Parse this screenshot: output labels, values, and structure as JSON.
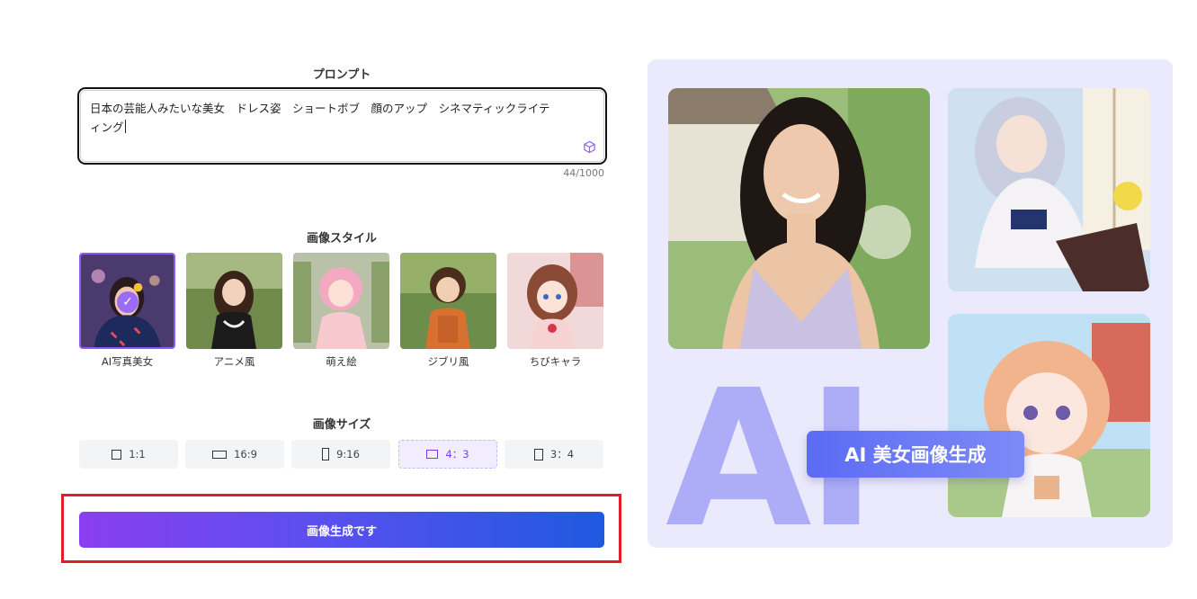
{
  "prompt_section": {
    "title": "プロンプト",
    "text": "日本の芸能人みたいな美女　ドレス姿　ショートボブ　顔のアップ　シネマティックライティング",
    "counter": "44/1000"
  },
  "style_section": {
    "title": "画像スタイル",
    "styles": [
      {
        "label": "AI写真美女",
        "selected": true
      },
      {
        "label": "アニメ風",
        "selected": false
      },
      {
        "label": "萌え絵",
        "selected": false
      },
      {
        "label": "ジブリ風",
        "selected": false
      },
      {
        "label": "ちびキャラ",
        "selected": false
      }
    ]
  },
  "size_section": {
    "title": "画像サイズ",
    "sizes": [
      {
        "label": "1:1",
        "selected": false
      },
      {
        "label": "16:9",
        "selected": false
      },
      {
        "label": "9:16",
        "selected": false
      },
      {
        "label": "4：3",
        "selected": true
      },
      {
        "label": "3：4",
        "selected": false
      }
    ]
  },
  "generate_button": {
    "label": "画像生成です"
  },
  "showcase": {
    "big_text": "AI",
    "badge": "AI 美女画像生成"
  },
  "colors": {
    "accent": "#8b5cf6",
    "highlight": "#e11d2b",
    "panel_bg": "#ebeafc"
  }
}
